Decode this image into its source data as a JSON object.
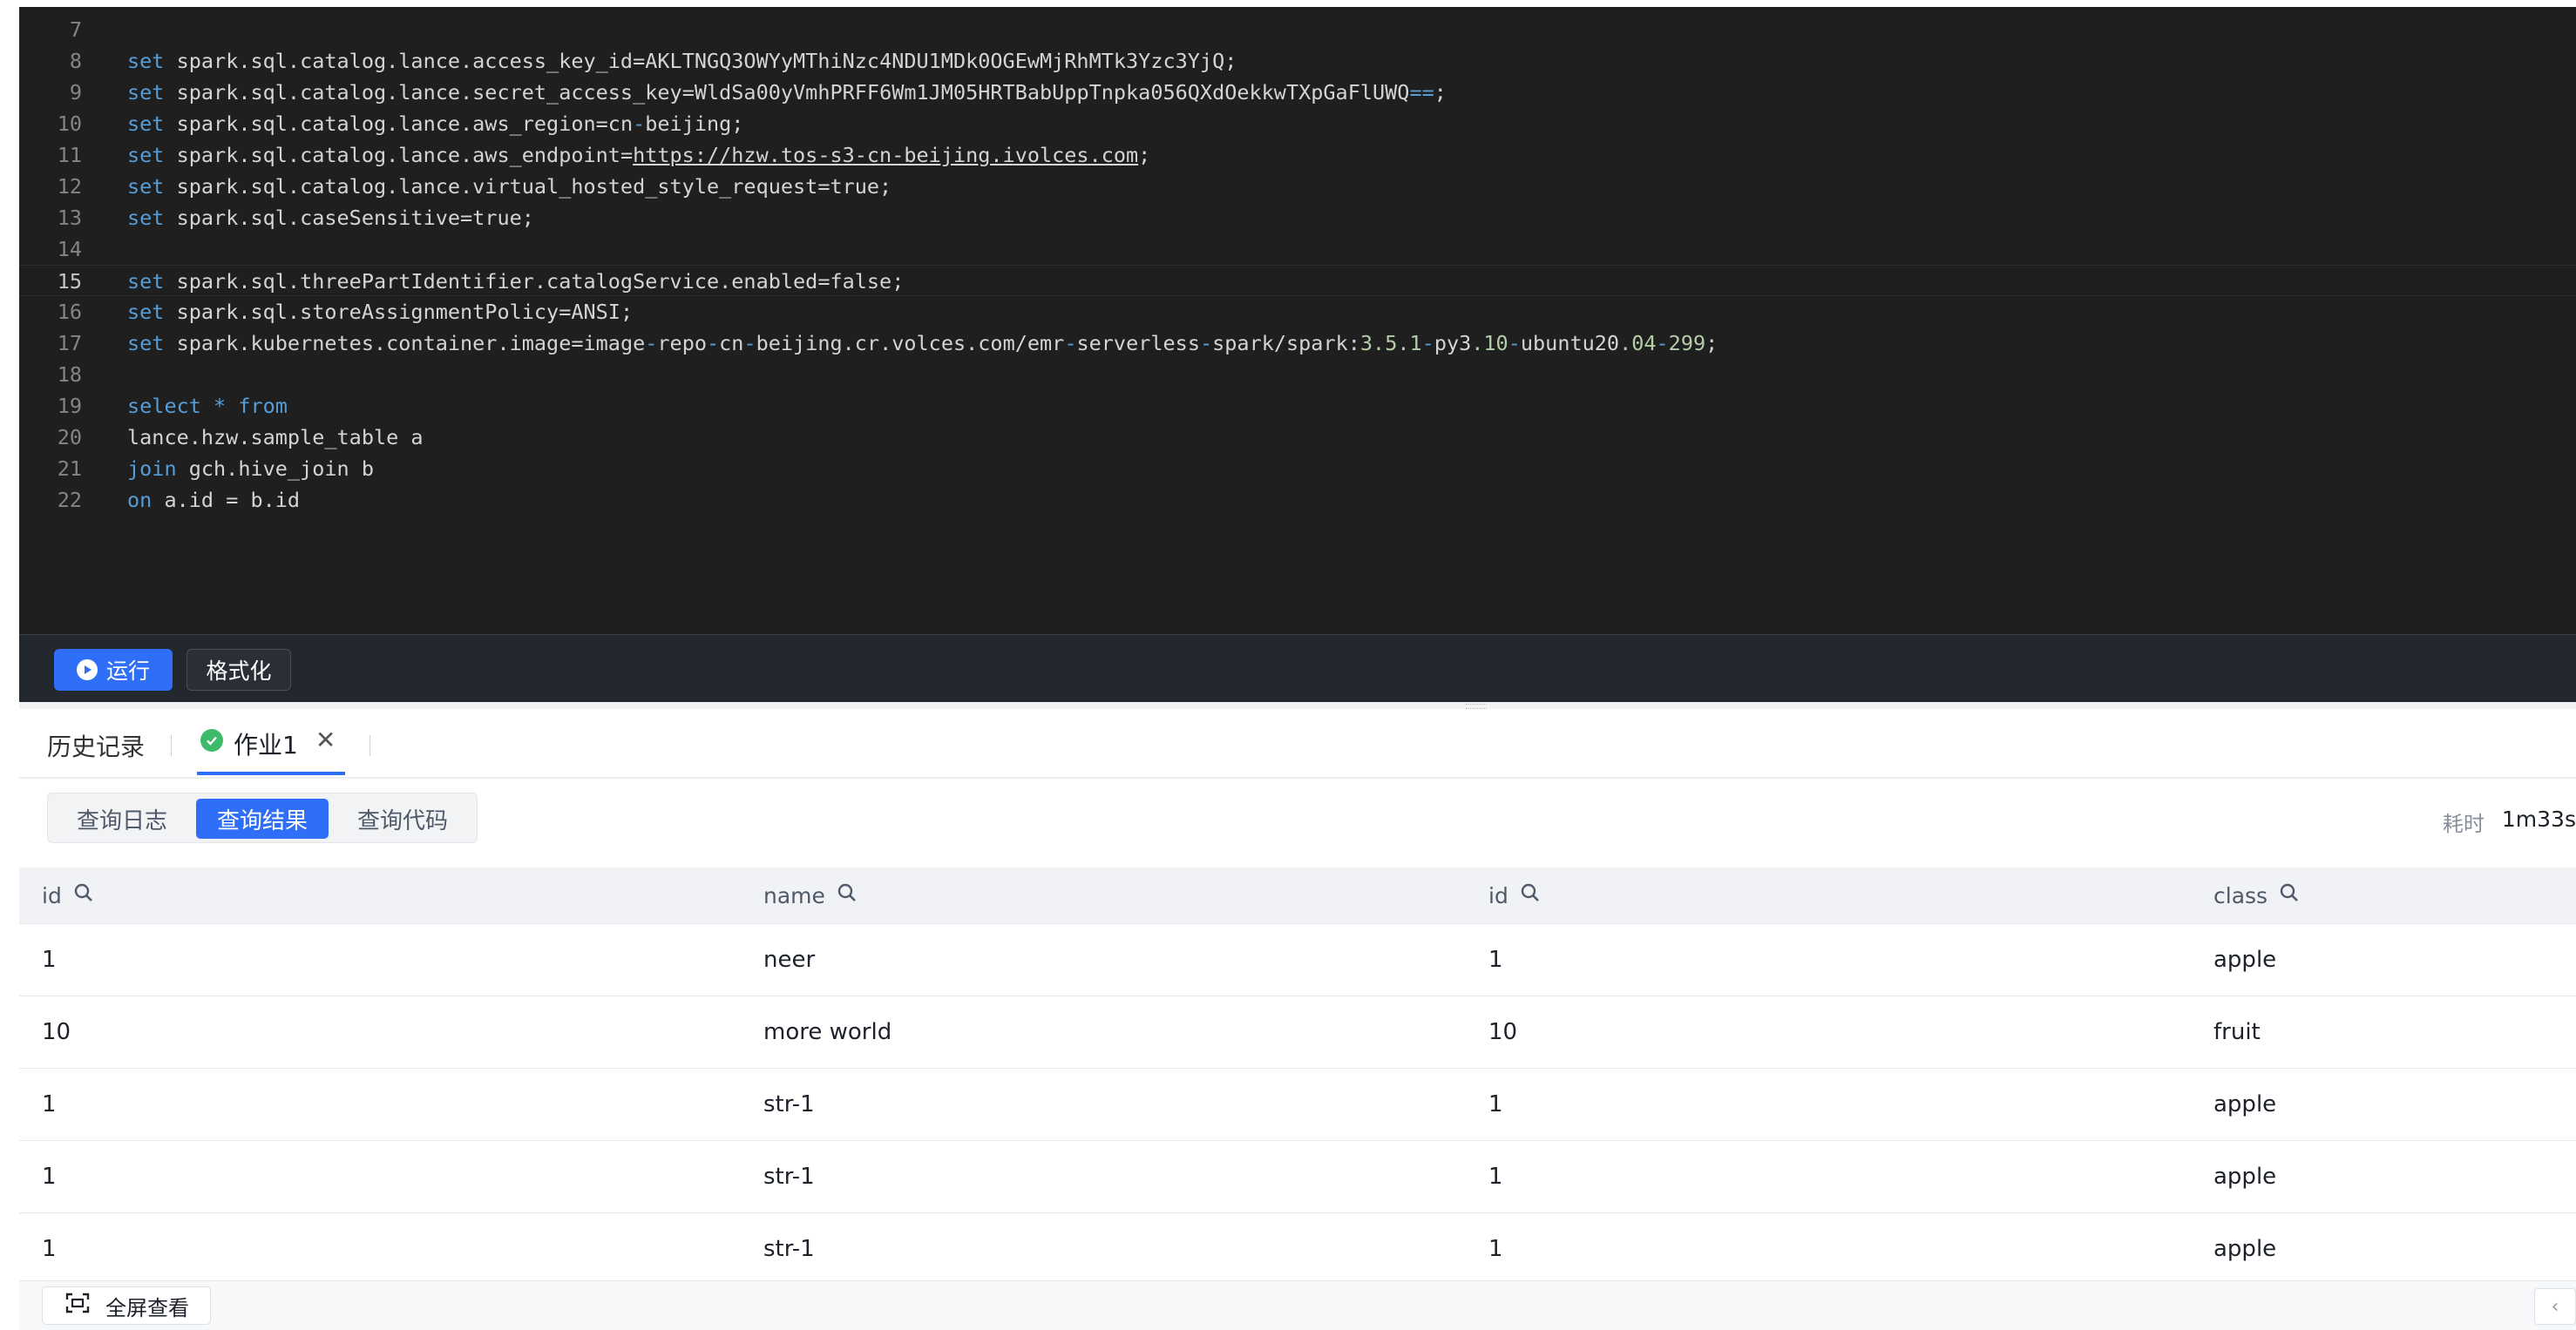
{
  "editor": {
    "lines": [
      {
        "n": "7",
        "segs": []
      },
      {
        "n": "8",
        "segs": [
          [
            "kw",
            "set"
          ],
          [
            "t",
            " spark.sql.catalog.lance.access_key_id"
          ],
          [
            "op",
            "="
          ],
          [
            "t",
            "AKLTNGQ3OWYyMThiNzc4NDU1MDk0OGEwMjRhMTk3Yzc3YjQ;"
          ]
        ]
      },
      {
        "n": "9",
        "segs": [
          [
            "kw",
            "set"
          ],
          [
            "t",
            " spark.sql.catalog.lance.secret_access_key"
          ],
          [
            "op",
            "="
          ],
          [
            "t",
            "WldSa00yVmhPRFF6Wm1JM05HRTBabUppTnpka056QXdOekkwTXpGaFlUWQ"
          ],
          [
            "kw",
            "=="
          ],
          [
            "t",
            ";"
          ]
        ]
      },
      {
        "n": "10",
        "segs": [
          [
            "kw",
            "set"
          ],
          [
            "t",
            " spark.sql.catalog.lance.aws_region"
          ],
          [
            "op",
            "="
          ],
          [
            "t",
            "cn"
          ],
          [
            "kw",
            "-"
          ],
          [
            "t",
            "beijing;"
          ]
        ]
      },
      {
        "n": "11",
        "segs": [
          [
            "kw",
            "set"
          ],
          [
            "t",
            " spark.sql.catalog.lance.aws_endpoint"
          ],
          [
            "op",
            "="
          ],
          [
            "url",
            "https://hzw.tos-s3-cn-beijing.ivolces.com"
          ],
          [
            "t",
            ";"
          ]
        ]
      },
      {
        "n": "12",
        "segs": [
          [
            "kw",
            "set"
          ],
          [
            "t",
            " spark.sql.catalog.lance.virtual_hosted_style_request"
          ],
          [
            "op",
            "="
          ],
          [
            "t",
            "true;"
          ]
        ]
      },
      {
        "n": "13",
        "segs": [
          [
            "kw",
            "set"
          ],
          [
            "t",
            " spark.sql.caseSensitive"
          ],
          [
            "op",
            "="
          ],
          [
            "t",
            "true;"
          ]
        ]
      },
      {
        "n": "14",
        "segs": []
      },
      {
        "n": "15",
        "segs": [
          [
            "kw",
            "set"
          ],
          [
            "t",
            " spark.sql.threePartIdentifier.catalogService.enabled"
          ],
          [
            "op",
            "="
          ],
          [
            "t",
            "false;"
          ]
        ],
        "active": true
      },
      {
        "n": "16",
        "segs": [
          [
            "kw",
            "set"
          ],
          [
            "t",
            " spark.sql.storeAssignmentPolicy"
          ],
          [
            "op",
            "="
          ],
          [
            "t",
            "ANSI;"
          ]
        ]
      },
      {
        "n": "17",
        "segs": [
          [
            "kw",
            "set"
          ],
          [
            "t",
            " spark.kubernetes.container.image"
          ],
          [
            "op",
            "="
          ],
          [
            "t",
            "image"
          ],
          [
            "kw",
            "-"
          ],
          [
            "t",
            "repo"
          ],
          [
            "kw",
            "-"
          ],
          [
            "t",
            "cn"
          ],
          [
            "kw",
            "-"
          ],
          [
            "t",
            "beijing.cr.volces.com/emr"
          ],
          [
            "kw",
            "-"
          ],
          [
            "t",
            "serverless"
          ],
          [
            "kw",
            "-"
          ],
          [
            "t",
            "spark/spark:"
          ],
          [
            "num",
            "3.5.1"
          ],
          [
            "kw",
            "-"
          ],
          [
            "t",
            "py3"
          ],
          [
            "num",
            ".10"
          ],
          [
            "kw",
            "-"
          ],
          [
            "t",
            "ubuntu20"
          ],
          [
            "num",
            ".04"
          ],
          [
            "kw",
            "-"
          ],
          [
            "num",
            "299"
          ],
          [
            "t",
            ";"
          ]
        ]
      },
      {
        "n": "18",
        "segs": []
      },
      {
        "n": "19",
        "segs": [
          [
            "kw",
            "select"
          ],
          [
            "t",
            " "
          ],
          [
            "kw",
            "*"
          ],
          [
            "t",
            " "
          ],
          [
            "kw",
            "from"
          ]
        ]
      },
      {
        "n": "20",
        "segs": [
          [
            "t",
            "lance.hzw.sample_table a"
          ]
        ]
      },
      {
        "n": "21",
        "segs": [
          [
            "kw",
            "join"
          ],
          [
            "t",
            " gch.hive_join b"
          ]
        ]
      },
      {
        "n": "22",
        "segs": [
          [
            "kw",
            "on"
          ],
          [
            "t",
            " a.id "
          ],
          [
            "op",
            "="
          ],
          [
            "t",
            " b.id"
          ]
        ]
      }
    ]
  },
  "toolbar": {
    "run_label": "运行",
    "format_label": "格式化"
  },
  "tabs": {
    "history_label": "历史记录",
    "job_label": "作业1"
  },
  "subtabs": {
    "log": "查询日志",
    "result": "查询结果",
    "code": "查询代码"
  },
  "elapsed": {
    "label": "耗时",
    "value": "1m33s"
  },
  "table": {
    "columns": [
      "id",
      "name",
      "id",
      "class"
    ],
    "rows": [
      [
        "1",
        "neer",
        "1",
        "apple"
      ],
      [
        "10",
        "more world",
        "10",
        "fruit"
      ],
      [
        "1",
        "str-1",
        "1",
        "apple"
      ],
      [
        "1",
        "str-1",
        "1",
        "apple"
      ],
      [
        "1",
        "str-1",
        "1",
        "apple"
      ]
    ]
  },
  "footer": {
    "fullscreen_label": "全屏查看"
  },
  "colors": {
    "accent": "#2f6ef6",
    "editor_bg": "#1f1f1f",
    "keyword": "#569cd6",
    "success": "#3dbb6a"
  },
  "icons": [
    "play-icon",
    "check-circle-icon",
    "close-icon",
    "search-icon",
    "fullscreen-icon",
    "chevron-left-icon"
  ]
}
